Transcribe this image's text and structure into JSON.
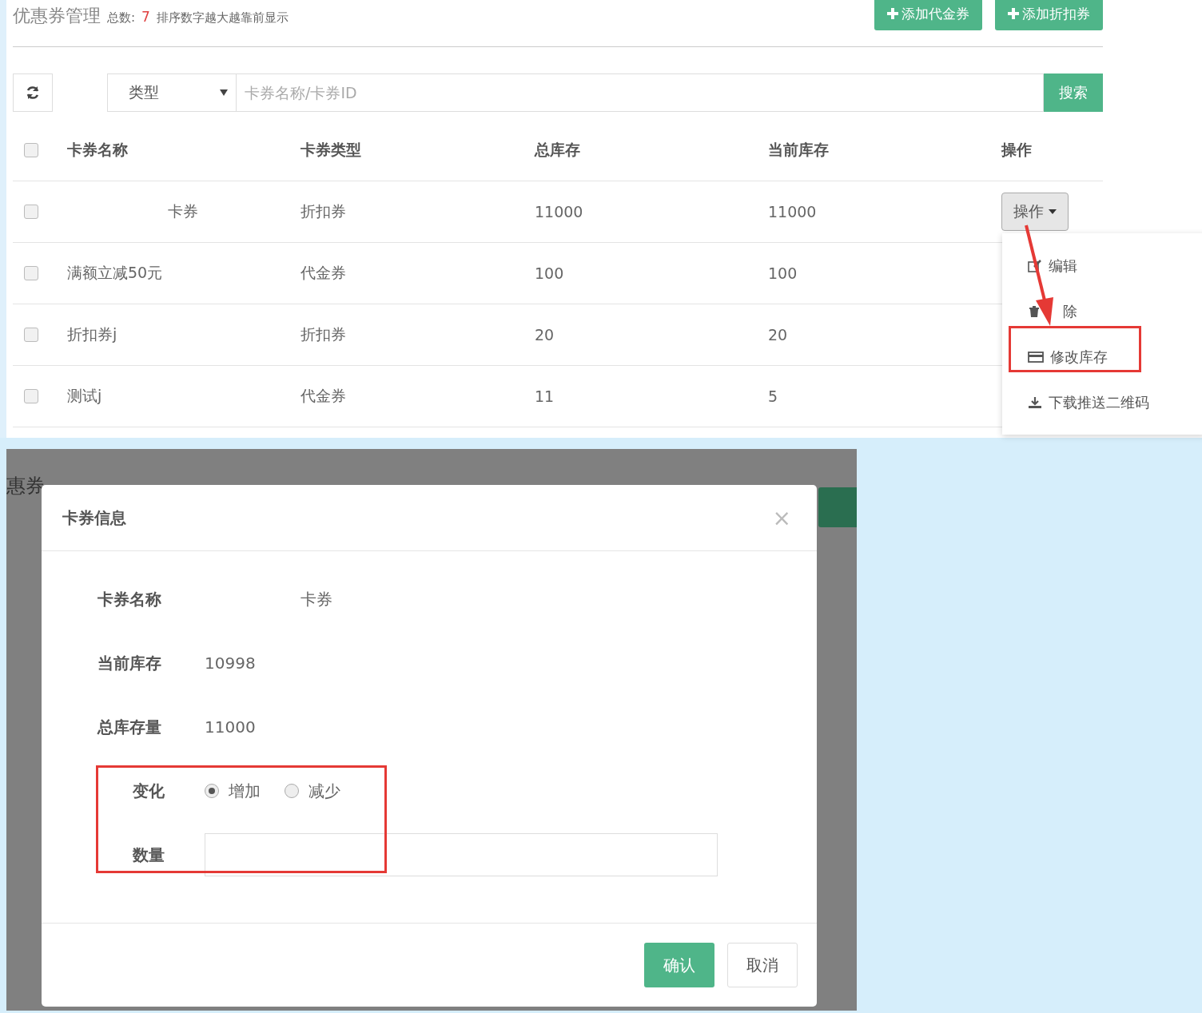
{
  "header": {
    "title": "优惠券管理",
    "count_label": "总数:",
    "count": "7",
    "hint": "排序数字越大越靠前显示",
    "buttons": [
      {
        "label": "添加代金券"
      },
      {
        "label": "添加折扣券"
      }
    ]
  },
  "toolbar": {
    "type_select": "类型",
    "search": {
      "placeholder": "卡券名称/卡券ID"
    },
    "search_button": "搜索"
  },
  "table": {
    "columns": [
      "卡券名称",
      "卡券类型",
      "总库存",
      "当前库存",
      "操作"
    ],
    "header_checked": false,
    "rows": [
      {
        "checked": false,
        "name": "卡券",
        "type": "折扣券",
        "total": "11000",
        "current": "11000",
        "action": "操作",
        "menu_open": true
      },
      {
        "checked": false,
        "name": "满额立减50元",
        "type": "代金券",
        "total": "100",
        "current": "100"
      },
      {
        "checked": false,
        "name": "折扣券j",
        "type": "折扣券",
        "total": "20",
        "current": "20"
      },
      {
        "checked": false,
        "name": "测试j",
        "type": "代金券",
        "total": "11",
        "current": "5"
      }
    ]
  },
  "action_menu": {
    "items": [
      {
        "label": "编辑",
        "highlighted": false
      },
      {
        "label": "除",
        "highlighted": false
      },
      {
        "label": "修改库存",
        "highlighted": true
      },
      {
        "label": "下载推送二维码",
        "highlighted": false
      }
    ]
  },
  "backdrop": {
    "title": "惠券"
  },
  "dialog": {
    "title": "卡券信息",
    "close": "×",
    "fields": [
      {
        "label": "卡券名称",
        "value": "卡券"
      },
      {
        "label": "当前库存",
        "value": "10998"
      },
      {
        "label": "总库存量",
        "value": "11000"
      }
    ],
    "change": {
      "label": "变化",
      "options": [
        {
          "label": "增加",
          "selected": true
        },
        {
          "label": "减少",
          "selected": false
        }
      ]
    },
    "quantity": {
      "label": "数量"
    },
    "buttons": [
      {
        "kind": "primary",
        "label": "确认"
      },
      {
        "kind": "default",
        "label": "取消"
      }
    ]
  }
}
